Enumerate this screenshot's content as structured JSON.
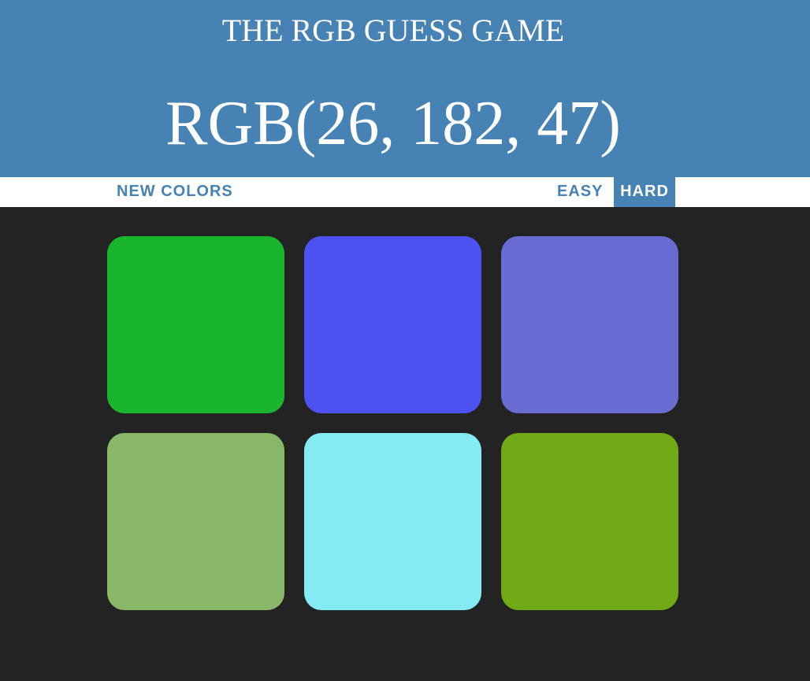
{
  "header": {
    "title": "THE RGB GUESS GAME",
    "target_color": "RGB(26, 182, 47)"
  },
  "controls": {
    "new_colors_label": "NEW COLORS",
    "easy_label": "EASY",
    "hard_label": "HARD",
    "selected_mode": "HARD"
  },
  "colors": {
    "header_bg": "#4682b4",
    "accent": "#4682b4",
    "board_bg": "#232323"
  },
  "squares": [
    {
      "color": "#1ab52f"
    },
    {
      "color": "#4d53f2"
    },
    {
      "color": "#686cd3"
    },
    {
      "color": "#88b867"
    },
    {
      "color": "#84ebf2"
    },
    {
      "color": "#70aa17"
    }
  ]
}
